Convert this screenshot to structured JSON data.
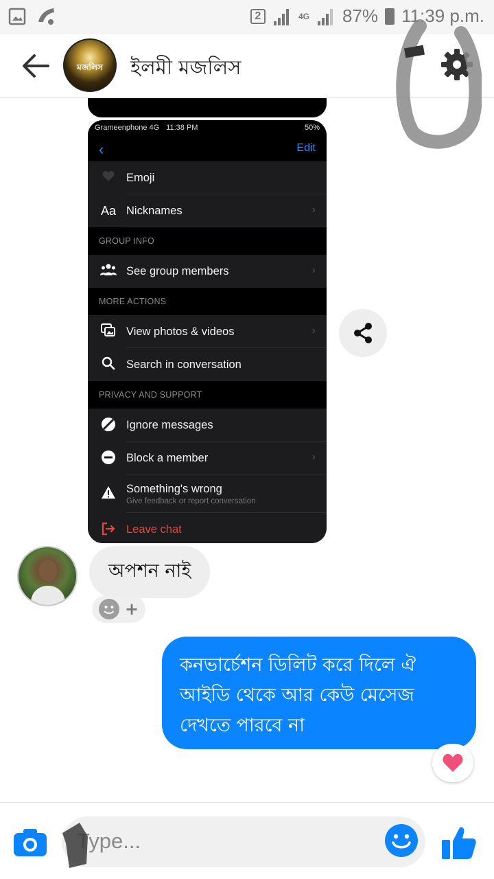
{
  "status_bar": {
    "sim_slot": "2",
    "network": "4G",
    "battery": "87%",
    "time": "11:39 p.m."
  },
  "header": {
    "group_name": "ইলমী মজলিস",
    "avatar_text": "মজলিস"
  },
  "messages": {
    "screenshot": {
      "status_carrier": "Grameenphone  4G",
      "status_time": "11:38 PM",
      "status_battery": "50%",
      "edit_label": "Edit",
      "rows_top": [
        {
          "icon": "heart-icon",
          "label": "Emoji",
          "arrow": false
        },
        {
          "icon": "aa-icon",
          "label": "Nicknames",
          "arrow": true
        }
      ],
      "section_group": "GROUP INFO",
      "see_members": "See group members",
      "section_more": "MORE ACTIONS",
      "view_photos": "View photos & videos",
      "search_conv": "Search in conversation",
      "section_privacy": "PRIVACY AND SUPPORT",
      "ignore": "Ignore messages",
      "block": "Block a member",
      "wrong_title": "Something's wrong",
      "wrong_sub": "Give feedback or report conversation",
      "leave": "Leave chat",
      "aa_label": "Aa"
    },
    "incoming_text": "অপশন নাই",
    "outgoing_text": "কনভার্চেশন ডিলিট করে দিলে ঐ আইডি থেকে আর কেউ মেসেজ দেখতে পারবে না"
  },
  "composer": {
    "placeholder": "Type..."
  },
  "colors": {
    "accent": "#0a84ff",
    "heart": "#f0507a",
    "danger": "#e8453c"
  }
}
